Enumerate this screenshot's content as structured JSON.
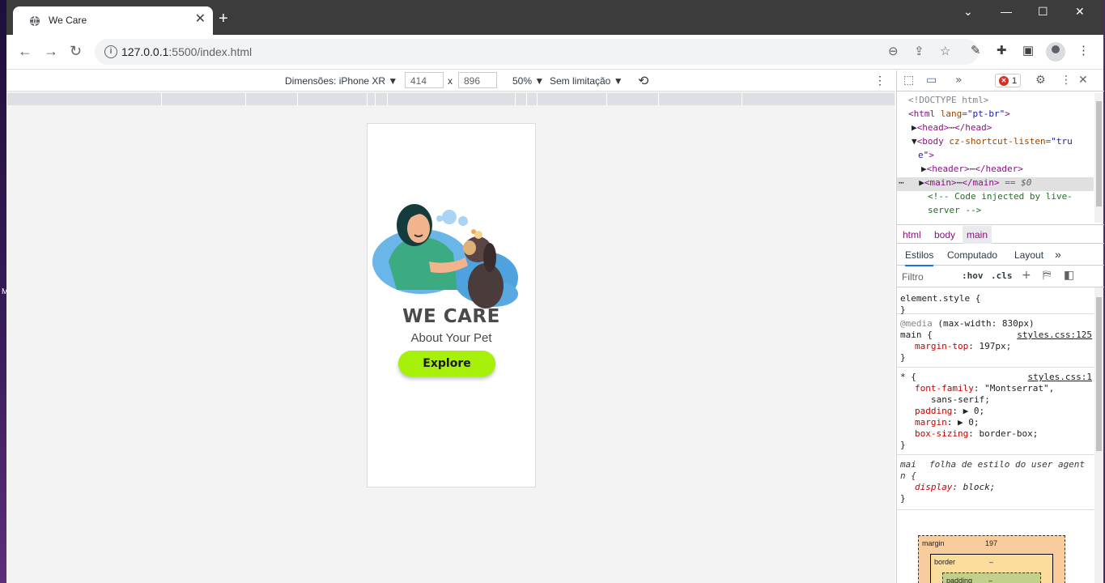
{
  "tab": {
    "title": "We Care",
    "close": "✕",
    "new_tab": "+"
  },
  "window_controls": {
    "minimize": "—",
    "maximize": "☐",
    "close": "✕",
    "tabsearch": "⌄"
  },
  "address": {
    "host": "127.0.0.1",
    "rest": ":5500/index.html"
  },
  "device_toolbar": {
    "dimensions_label": "Dimensões: iPhone XR",
    "width": "414",
    "times": "x",
    "height": "896",
    "zoom": "50%",
    "throttle": "Sem limitação"
  },
  "page": {
    "brand": "WE CARE",
    "tagline": "About Your Pet",
    "cta": "Explore"
  },
  "devtools": {
    "error_count": "1",
    "dom": {
      "doctype": "<!DOCTYPE html>",
      "html_open": "<html ",
      "html_attr": "lang=",
      "html_val": "\"pt-br\"",
      "html_close": ">",
      "head_open": "<head>",
      "ellipsis": "⋯",
      "head_close": "</head>",
      "body_open": "<body ",
      "body_attr": "cz-shortcut-listen=",
      "body_val1": "\"tru",
      "body_val2": "e\"",
      "body_close": ">",
      "header_open": "<header>",
      "header_close": "</header>",
      "main_open": "<main>",
      "main_close": "</main>",
      "main_marker": " == $0",
      "comment1": "<!-- Code injected by live-",
      "comment2": "server -->"
    },
    "breadcrumbs": [
      "html",
      "body",
      "main"
    ],
    "style_tabs": [
      "Estilos",
      "Computado",
      "Layout"
    ],
    "filter_placeholder": "Filtro",
    "hov": ":hov",
    "cls": ".cls",
    "rules": {
      "element_style": "element.style {",
      "close": "}",
      "media": "@media",
      "media_query": " (max-width: 830px)",
      "main_sel": "main {",
      "main_src": "styles.css:125",
      "main_prop": "margin-top",
      "main_val": ": 197px;",
      "star_sel": "* {",
      "star_src": "styles.css:1",
      "ff_prop": "font-family",
      "ff_val": ": \"Montserrat\",",
      "ff_val2": "sans-serif;",
      "pad_prop": "padding",
      "pad_val": ": ▶ 0;",
      "mar_prop": "margin",
      "mar_val": ": ▶ 0;",
      "bs_prop": "box-sizing",
      "bs_val": ": border-box;",
      "ua_sel1": "mai",
      "ua_src": "folha de estilo do user agent",
      "ua_sel2": "n {",
      "disp_prop": "display",
      "disp_val": ": block;"
    },
    "boxmodel": {
      "margin_label": "margin",
      "margin_val": "197",
      "border_label": "border",
      "border_val": "–",
      "padding_label": "padding",
      "padding_val": "–"
    }
  },
  "desktop_edge_text": "M"
}
